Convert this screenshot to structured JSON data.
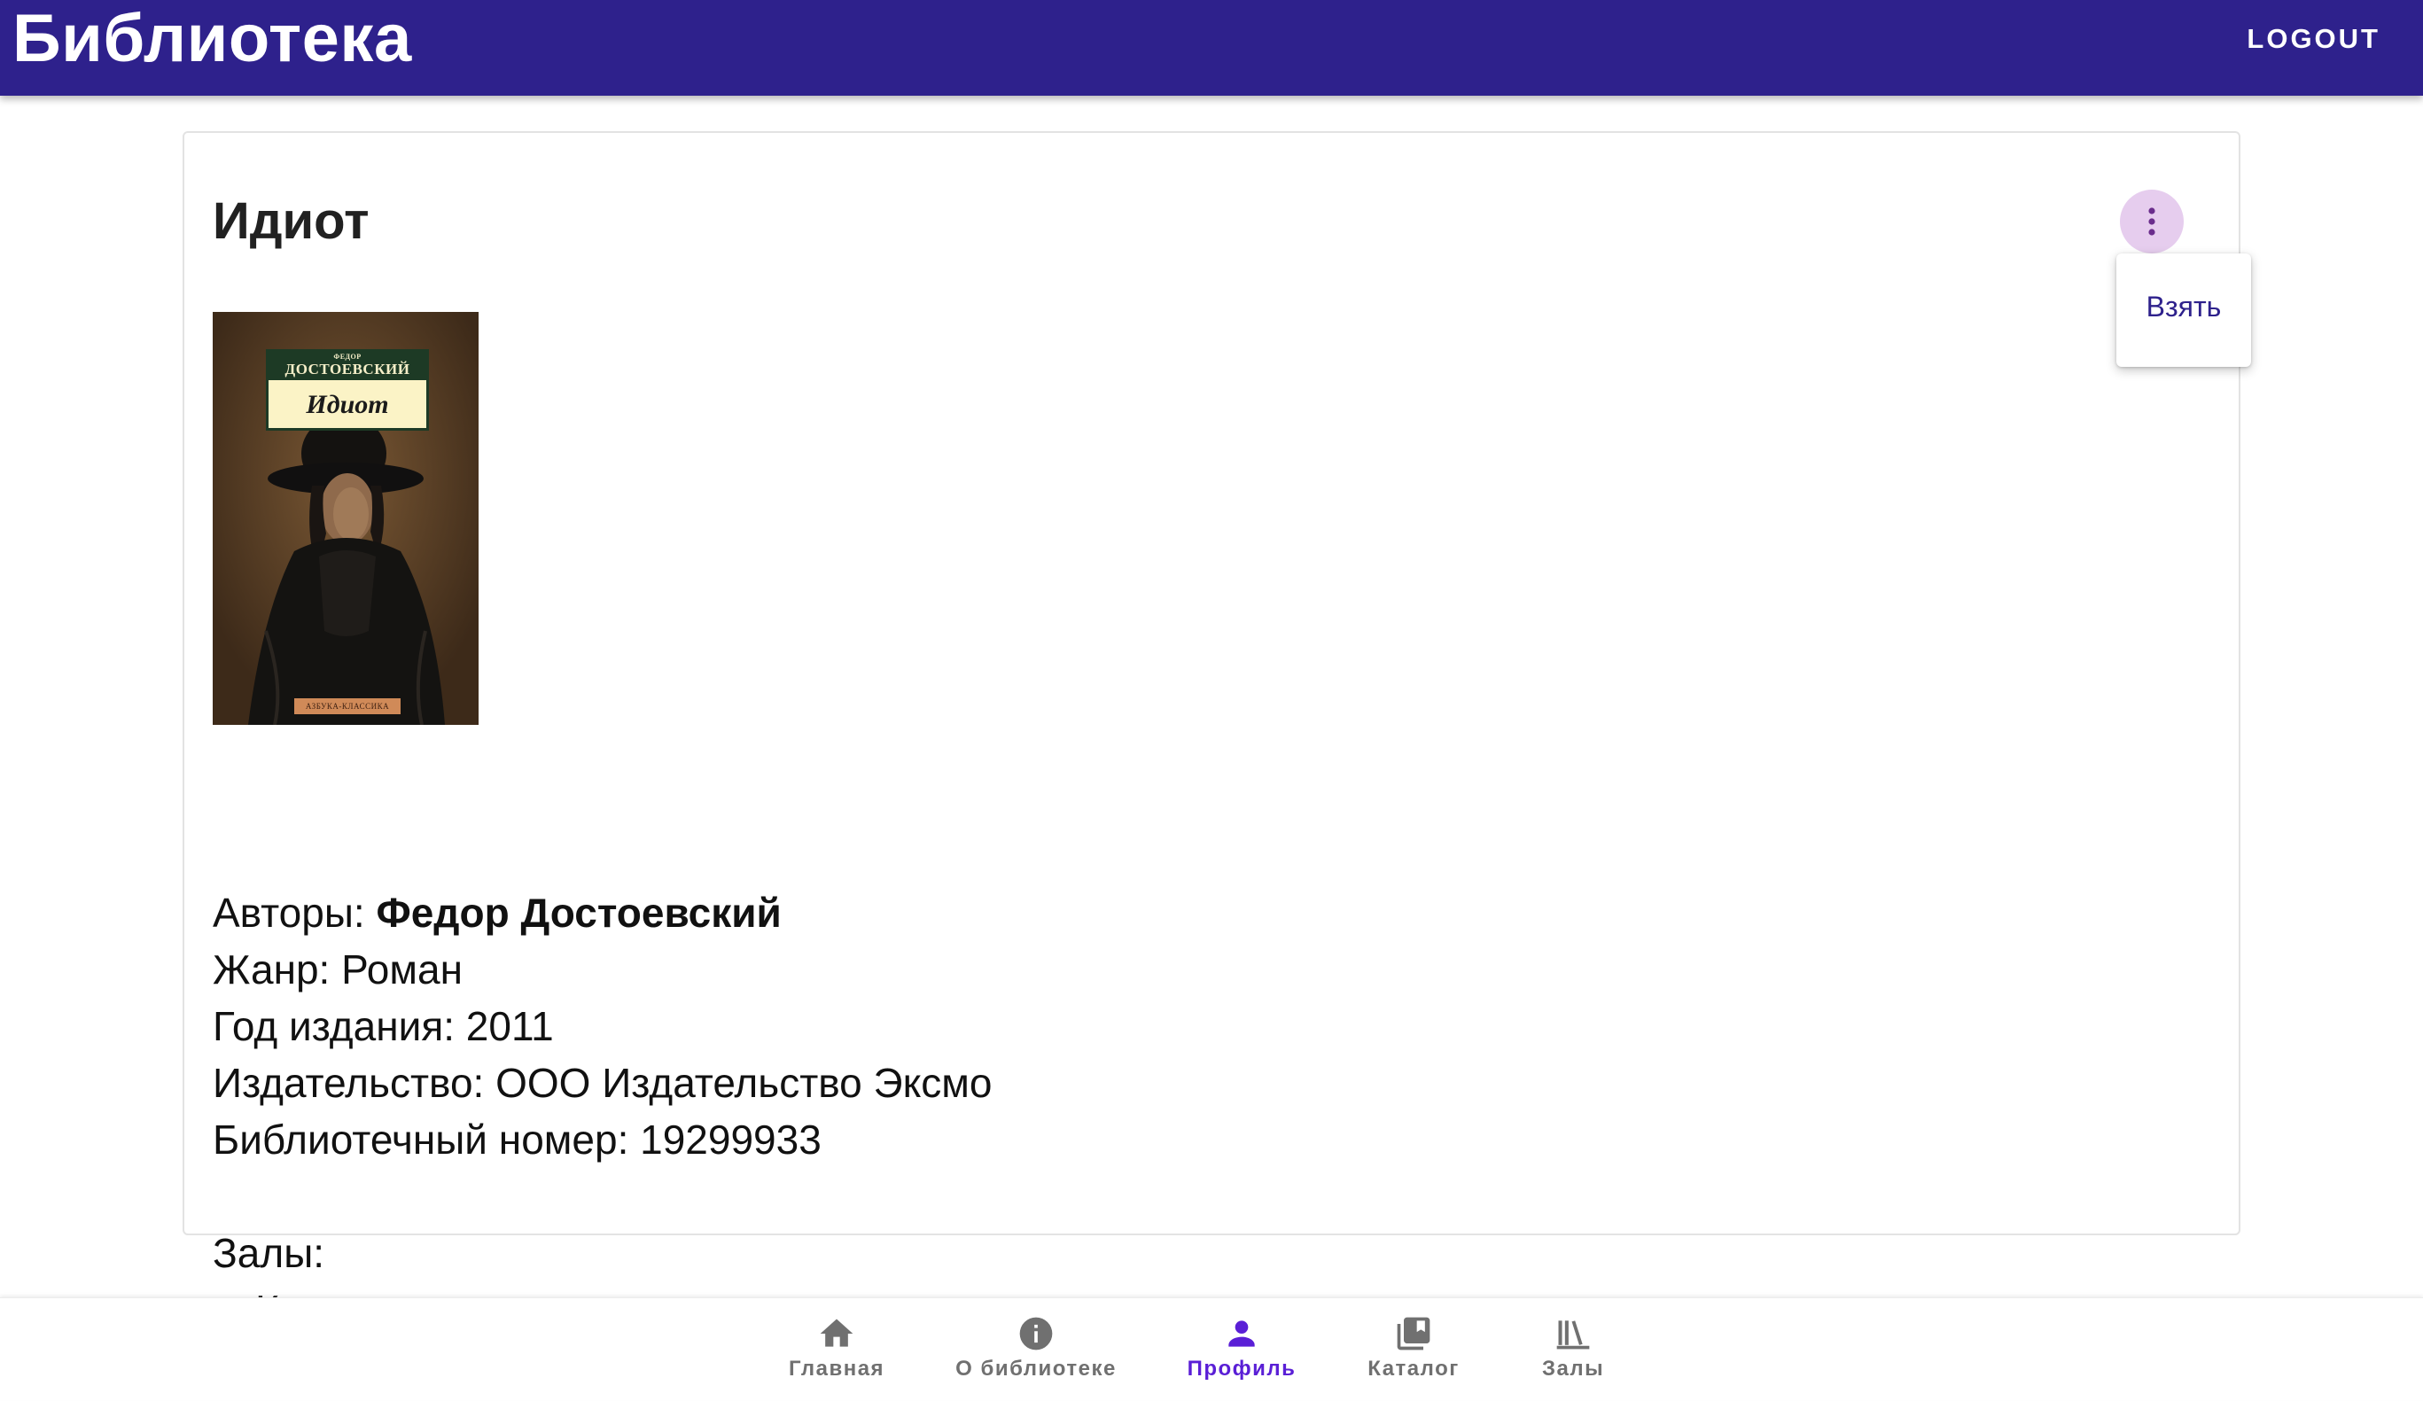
{
  "app": {
    "title": "Библиотека",
    "logout_label": "LOGOUT"
  },
  "book": {
    "title": "Идиот",
    "cover": {
      "author_small": "ФЕДОР",
      "author": "ДОСТОЕВСКИЙ",
      "title": "Идиот",
      "series": "АЗБУКА-КЛАССИКА"
    },
    "authors_label": "Авторы: ",
    "authors_value": "Федор Достоевский",
    "genre_text": "Жанр: Роман",
    "year_text": "Год издания: 2011",
    "publisher_text": "Издательство: ООО Издательство Эксмо",
    "library_number_text": "Библиотечный номер: 19299933",
    "halls_label": "Залы:",
    "halls": [
      "Классика"
    ]
  },
  "menu": {
    "take_label": "Взять"
  },
  "bottom_nav": {
    "items": [
      {
        "label": "Главная",
        "icon": "home-icon",
        "active": false
      },
      {
        "label": "О библиотеке",
        "icon": "info-icon",
        "active": false
      },
      {
        "label": "Профиль",
        "icon": "person-icon",
        "active": true
      },
      {
        "label": "Каталог",
        "icon": "book-icon",
        "active": false
      },
      {
        "label": "Залы",
        "icon": "library-icon",
        "active": false
      }
    ]
  },
  "colors": {
    "appbar": "#2e218c",
    "accent": "#5a1fd6",
    "more_button_bg": "#e6cdee",
    "nav_inactive": "#707070"
  }
}
